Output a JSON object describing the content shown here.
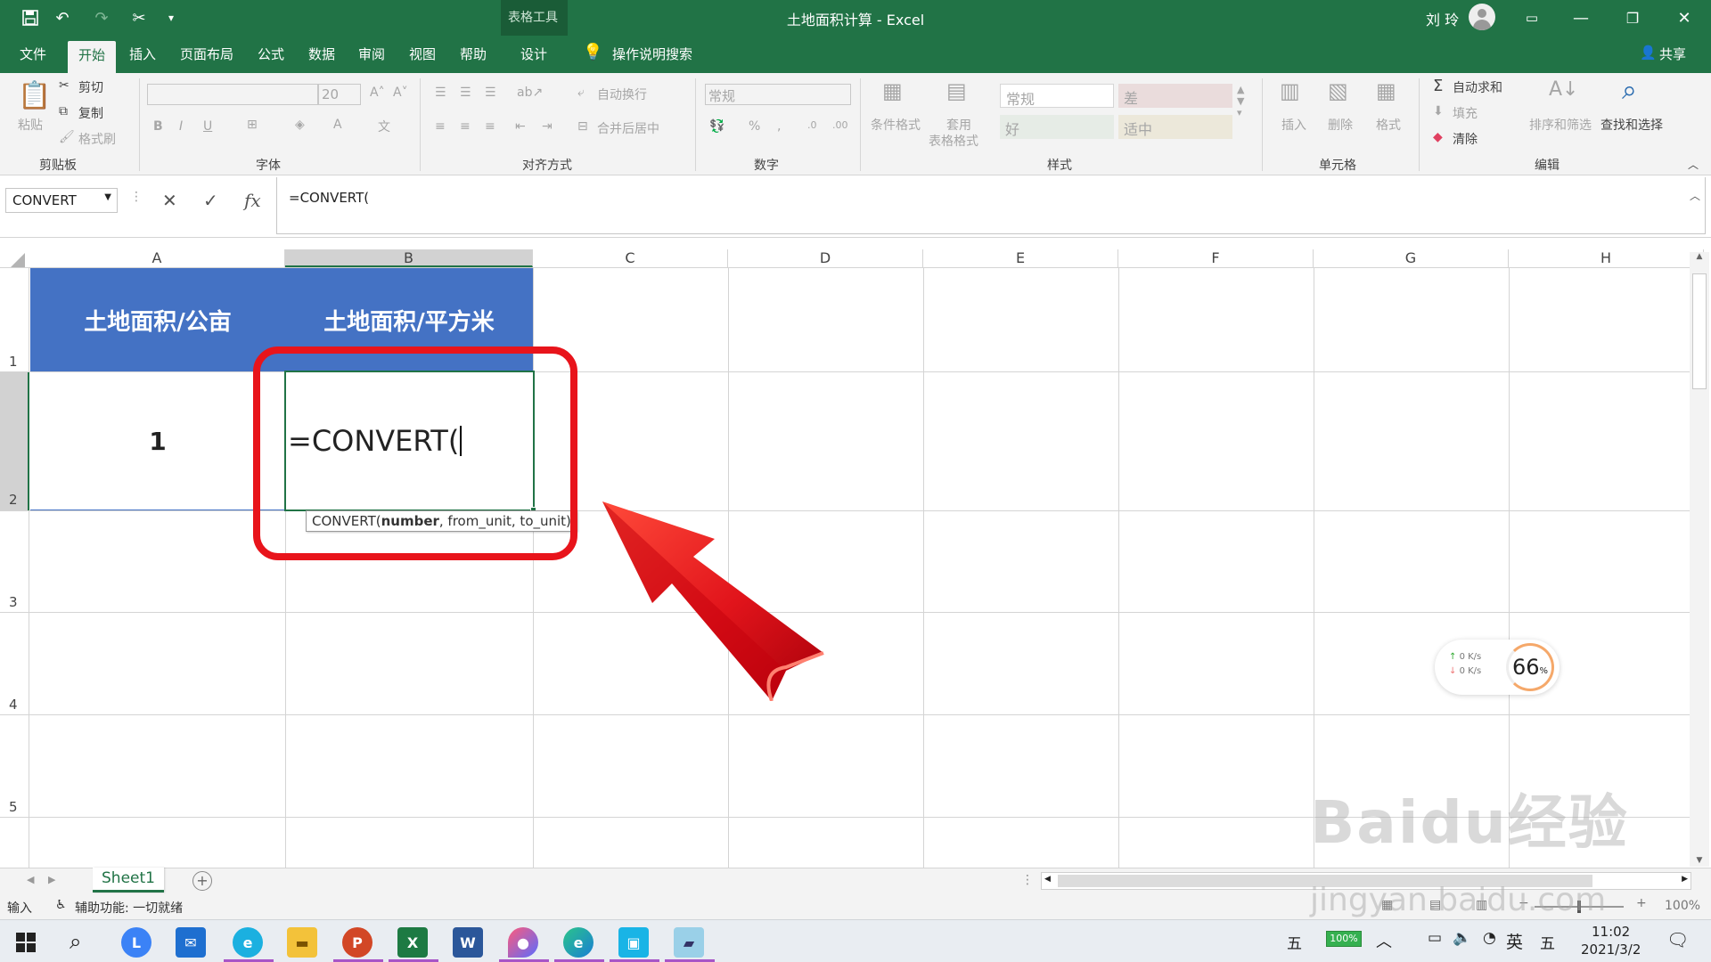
{
  "titlebar": {
    "title": "土地面积计算  -  Excel",
    "contextual_label": "表格工具",
    "user": "刘 玲"
  },
  "tabs": [
    {
      "label": "文件"
    },
    {
      "label": "开始"
    },
    {
      "label": "插入"
    },
    {
      "label": "页面布局"
    },
    {
      "label": "公式"
    },
    {
      "label": "数据"
    },
    {
      "label": "审阅"
    },
    {
      "label": "视图"
    },
    {
      "label": "帮助"
    },
    {
      "label": "设计"
    },
    {
      "label": "操作说明搜索"
    }
  ],
  "share": "共享",
  "ribbon": {
    "clipboard": {
      "paste": "粘贴",
      "cut": "剪切",
      "copy": "复制",
      "format_painter": "格式刷",
      "group": "剪贴板"
    },
    "font": {
      "size": "20",
      "group": "字体"
    },
    "alignment": {
      "wrap": "自动换行",
      "merge": "合并后居中",
      "group": "对齐方式"
    },
    "number": {
      "format": "常规",
      "group": "数字"
    },
    "styles": {
      "conditional": "条件格式",
      "table_1": "套用",
      "table_2": "表格格式",
      "normal": "常规",
      "bad": "差",
      "good": "好",
      "neutral": "适中",
      "group": "样式"
    },
    "cells": {
      "insert": "插入",
      "delete": "删除",
      "format": "格式",
      "group": "单元格"
    },
    "editing": {
      "autosum": "自动求和",
      "fill": "填充",
      "clear": "清除",
      "sort": "排序和筛选",
      "find": "查找和选择",
      "group": "编辑"
    }
  },
  "formula": {
    "name_box": "CONVERT",
    "content": "=CONVERT("
  },
  "columns": [
    "A",
    "B",
    "C",
    "D",
    "E",
    "F",
    "G",
    "H"
  ],
  "rows": [
    "1",
    "2",
    "3",
    "4",
    "5"
  ],
  "cells": {
    "a1": "土地面积/公亩",
    "b1": "土地面积/平方米",
    "a2": "1",
    "b2": "=CONVERT("
  },
  "tooltip": {
    "fn": "CONVERT(",
    "arg1": "number",
    "rest": ", from_unit, to_unit)"
  },
  "sheet": {
    "tab": "Sheet1"
  },
  "status": {
    "mode": "输入",
    "accessibility": "辅助功能: 一切就绪",
    "zoom": "100%"
  },
  "net_widget": {
    "up": "0",
    "down": "0",
    "unit": "K/s",
    "value": "66",
    "pct": "%"
  },
  "taskbar": {
    "time": "11:02",
    "date": "2021/3/2",
    "battery": "100%",
    "ime1": "五",
    "ime2": "英",
    "ime3": "五"
  },
  "watermark": {
    "brand": "Baidu经验",
    "url": "jingyan.baidu.com"
  }
}
